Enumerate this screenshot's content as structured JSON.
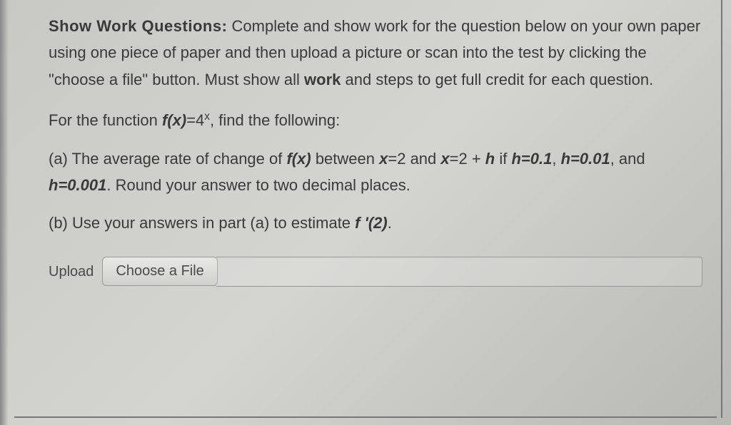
{
  "header": {
    "prefix": "Show Work Questions:",
    "instructions": "  Complete and show work for the question below on your own paper using one piece of paper and then upload a picture or scan into the test by clicking the \"choose a file\" button.  Must show all ",
    "work_word": "work",
    "instructions_end": " and steps to get full credit for each question."
  },
  "function_line": {
    "pre": "For the function ",
    "fx": "f(x)",
    "eq": "=4",
    "exp": "x",
    "post": ", find the following:"
  },
  "part_a": {
    "pre": "(a) The average rate of change of ",
    "fx": "f(x)",
    "between": " between ",
    "x1": "x",
    "x1_val": "=2",
    "and1": " and ",
    "x2": "x",
    "x2_val": "=2 + ",
    "h_sym": "h",
    "if": " if ",
    "h1": "h=0.1",
    "comma1": ", ",
    "h2": "h=0.01",
    "comma2": ", and ",
    "h3": "h=0.001",
    "end": ". Round your answer to two decimal places."
  },
  "part_b": {
    "pre": "(b)  Use your answers in part (a) to estimate ",
    "fprime": "f '(2)",
    "end": "."
  },
  "upload": {
    "label": "Upload",
    "button": "Choose a File"
  }
}
